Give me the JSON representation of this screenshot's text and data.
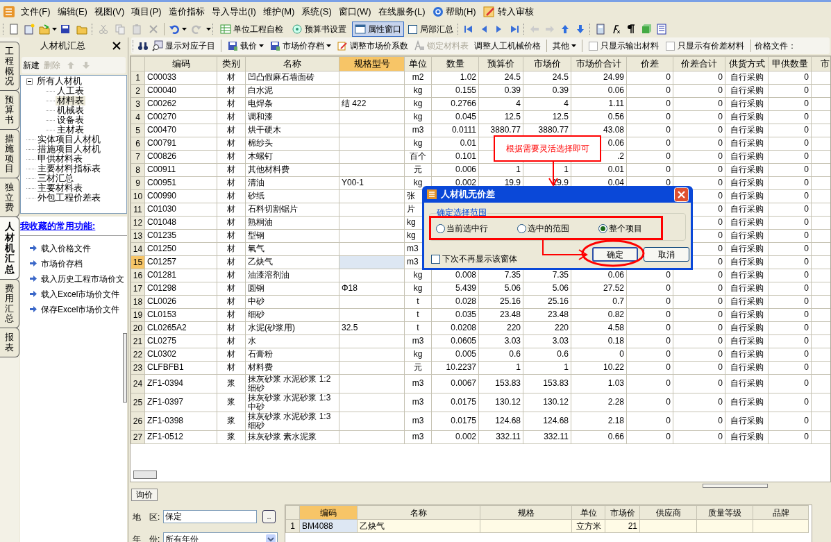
{
  "menu": [
    {
      "label": "文件(F)"
    },
    {
      "label": "编辑(E)"
    },
    {
      "label": "视图(V)"
    },
    {
      "label": "项目(P)"
    },
    {
      "label": "造价指标"
    },
    {
      "label": "导入导出(I)"
    },
    {
      "label": "维护(M)"
    },
    {
      "label": "系统(S)"
    },
    {
      "label": "窗口(W)"
    },
    {
      "label": "在线服务(L)"
    },
    {
      "label": "帮助(H)",
      "kind": "help"
    },
    {
      "label": "转入审核",
      "kind": "review"
    }
  ],
  "toolbar": [
    {
      "label": "单位工程自检",
      "pressed": false
    },
    {
      "label": "预算书设置",
      "pressed": false
    },
    {
      "label": "属性窗口",
      "pressed": true
    }
  ],
  "partial_summary": {
    "label": "局部汇总",
    "checked": false
  },
  "side_tabs": [
    {
      "label": "工程概况",
      "selected": false
    },
    {
      "label": "预算书",
      "selected": false
    },
    {
      "label": "措施项目",
      "selected": false
    },
    {
      "label": "独立费",
      "selected": false
    },
    {
      "label": "人材机汇总",
      "selected": true
    },
    {
      "label": "费用汇总",
      "selected": false
    },
    {
      "label": "报表",
      "selected": false
    }
  ],
  "panel": {
    "title": "人材机汇总",
    "actions": [
      {
        "label": "新建",
        "disabled": false
      },
      {
        "label": "删除",
        "disabled": true
      }
    ],
    "tree": [
      {
        "label": "所有人材机",
        "expanded": true,
        "selected": false,
        "children": [
          {
            "label": "人工表",
            "selected": false
          },
          {
            "label": "材料表",
            "selected": true
          },
          {
            "label": "机械表",
            "selected": false
          },
          {
            "label": "设备表",
            "selected": false
          },
          {
            "label": "主材表",
            "selected": false
          }
        ]
      },
      {
        "label": "实体项目人材机",
        "selected": false
      },
      {
        "label": "措施项目人材机",
        "selected": false
      },
      {
        "label": "甲供材料表",
        "selected": false
      },
      {
        "label": "主要材料指标表",
        "selected": false
      },
      {
        "label": "三材汇总",
        "selected": false
      },
      {
        "label": "主要材料表",
        "selected": false
      },
      {
        "label": "外包工程价差表",
        "selected": false
      }
    ],
    "favorites_title": "我收藏的常用功能:",
    "favorites": [
      "载入价格文件",
      "市场价存档",
      "载入历史工程市场价文",
      "载入Excel市场价文件",
      "保存Excel市场价文件"
    ]
  },
  "toolbar2": [
    {
      "kind": "button",
      "label": "显示对应子目",
      "disabled": false
    },
    {
      "kind": "dropdown",
      "label": "载价",
      "disabled": false
    },
    {
      "kind": "dropdown",
      "label": "市场价存档",
      "disabled": false
    },
    {
      "kind": "button",
      "label": "调整市场价系数",
      "disabled": false
    },
    {
      "kind": "button",
      "label": "锁定材料表",
      "disabled": true
    },
    {
      "kind": "button",
      "label": "调整人工机械价格",
      "disabled": false
    },
    {
      "kind": "dropdown",
      "label": "其他",
      "disabled": false
    },
    {
      "kind": "checkbox",
      "label": "只显示输出材料",
      "checked": false
    },
    {
      "kind": "checkbox",
      "label": "只显示有价差材料",
      "checked": false
    },
    {
      "kind": "label",
      "label": "价格文件："
    }
  ],
  "table": {
    "columns": [
      {
        "label": "编码",
        "selected": false
      },
      {
        "label": "类别",
        "selected": false
      },
      {
        "label": "名称",
        "selected": false
      },
      {
        "label": "规格型号",
        "selected": true
      },
      {
        "label": "单位",
        "selected": false
      },
      {
        "label": "数量",
        "selected": false
      },
      {
        "label": "预算价",
        "selected": false
      },
      {
        "label": "市场价",
        "selected": false
      },
      {
        "label": "市场价合计",
        "selected": false
      },
      {
        "label": "价差",
        "selected": false
      },
      {
        "label": "价差合计",
        "selected": false
      },
      {
        "label": "供货方式",
        "selected": false
      },
      {
        "label": "甲供数量",
        "selected": false
      },
      {
        "label": "市",
        "selected": false
      }
    ],
    "rows": [
      {
        "no": "1",
        "selected": false,
        "cells": [
          "C00033",
          "材",
          "凹凸假麻石墙面砖",
          null,
          "m2",
          "1.02",
          "24.5",
          "24.5",
          "24.99",
          "0",
          "0",
          "自行采购",
          "0"
        ]
      },
      {
        "no": "2",
        "selected": false,
        "cells": [
          "C00040",
          "材",
          "白水泥",
          null,
          "kg",
          "0.155",
          "0.39",
          "0.39",
          "0.06",
          "0",
          "0",
          "自行采购",
          "0"
        ]
      },
      {
        "no": "3",
        "selected": false,
        "cells": [
          "C00262",
          "材",
          "电焊条",
          "结 422",
          "kg",
          "0.2766",
          "4",
          "4",
          "1.11",
          "0",
          "0",
          "自行采购",
          "0"
        ]
      },
      {
        "no": "4",
        "selected": false,
        "cells": [
          "C00270",
          "材",
          "调和漆",
          null,
          "kg",
          "0.045",
          "12.5",
          "12.5",
          "0.56",
          "0",
          "0",
          "自行采购",
          "0"
        ]
      },
      {
        "no": "5",
        "selected": false,
        "cells": [
          "C00470",
          "材",
          "烘干硬木",
          null,
          "m3",
          "0.0111",
          "3880.77",
          "3880.77",
          "43.08",
          "0",
          "0",
          "自行采购",
          "0"
        ]
      },
      {
        "no": "6",
        "selected": false,
        "cells": [
          "C00791",
          "材",
          "棉纱头",
          null,
          "kg",
          "0.01",
          null,
          null,
          "0.06",
          "0",
          "0",
          "自行采购",
          "0"
        ]
      },
      {
        "no": "7",
        "selected": false,
        "cells": [
          "C00826",
          "材",
          "木螺钉",
          null,
          "百个",
          "0.101",
          null,
          null,
          ".2",
          "0",
          "0",
          "自行采购",
          "0"
        ]
      },
      {
        "no": "8",
        "selected": false,
        "cells": [
          "C00911",
          "材",
          "其他材料费",
          null,
          "元",
          "0.006",
          "1",
          "1",
          "0.01",
          "0",
          "0",
          "自行采购",
          "0"
        ]
      },
      {
        "no": "9",
        "selected": false,
        "cells": [
          "C00951",
          "材",
          "清油",
          "Y00-1",
          "kg",
          "0.002",
          "19.9",
          "19.9",
          "0.04",
          "0",
          "0",
          "自行采购",
          "0"
        ]
      },
      {
        "no": "10",
        "selected": false,
        "cells": [
          "C00990",
          "材",
          "砂纸",
          null,
          "张",
          null,
          null,
          null,
          null,
          null,
          "0",
          "自行采购",
          "0"
        ]
      },
      {
        "no": "11",
        "selected": false,
        "cells": [
          "C01030",
          "材",
          "石料切割锯片",
          null,
          "片",
          null,
          null,
          null,
          null,
          null,
          "0",
          "自行采购",
          "0"
        ]
      },
      {
        "no": "12",
        "selected": false,
        "cells": [
          "C01048",
          "材",
          "熟桐油",
          null,
          "kg",
          null,
          null,
          null,
          null,
          null,
          "0",
          "自行采购",
          "0"
        ]
      },
      {
        "no": "13",
        "selected": false,
        "cells": [
          "C01235",
          "材",
          "型钢",
          null,
          "kg",
          null,
          null,
          null,
          null,
          null,
          "0",
          "自行采购",
          "0"
        ]
      },
      {
        "no": "14",
        "selected": false,
        "cells": [
          "C01250",
          "材",
          "氧气",
          null,
          "m3",
          null,
          null,
          null,
          null,
          null,
          "0",
          "自行采购",
          "0"
        ]
      },
      {
        "no": "15",
        "selected": true,
        "cells": [
          "C01257",
          "材",
          "乙炔气",
          null,
          "m3",
          null,
          null,
          null,
          null,
          null,
          "0",
          "自行采购",
          "0"
        ]
      },
      {
        "no": "16",
        "selected": false,
        "cells": [
          "C01281",
          "材",
          "油漆溶剂油",
          null,
          "kg",
          "0.008",
          "7.35",
          "7.35",
          "0.06",
          "0",
          "0",
          "自行采购",
          "0"
        ]
      },
      {
        "no": "17",
        "selected": false,
        "cells": [
          "C01298",
          "材",
          "圆钢",
          "Φ18",
          "kg",
          "5.439",
          "5.06",
          "5.06",
          "27.52",
          "0",
          "0",
          "自行采购",
          "0"
        ]
      },
      {
        "no": "18",
        "selected": false,
        "cells": [
          "CL0026",
          "材",
          "中砂",
          null,
          "t",
          "0.028",
          "25.16",
          "25.16",
          "0.7",
          "0",
          "0",
          "自行采购",
          "0"
        ]
      },
      {
        "no": "19",
        "selected": false,
        "cells": [
          "CL0153",
          "材",
          "细砂",
          null,
          "t",
          "0.035",
          "23.48",
          "23.48",
          "0.82",
          "0",
          "0",
          "自行采购",
          "0"
        ]
      },
      {
        "no": "20",
        "selected": false,
        "cells": [
          "CL0265A2",
          "材",
          "水泥(砂浆用)",
          "32.5",
          "t",
          "0.0208",
          "220",
          "220",
          "4.58",
          "0",
          "0",
          "自行采购",
          "0"
        ]
      },
      {
        "no": "21",
        "selected": false,
        "cells": [
          "CL0275",
          "材",
          "水",
          null,
          "m3",
          "0.0605",
          "3.03",
          "3.03",
          "0.18",
          "0",
          "0",
          "自行采购",
          "0"
        ]
      },
      {
        "no": "22",
        "selected": false,
        "cells": [
          "CL0302",
          "材",
          "石膏粉",
          null,
          "kg",
          "0.005",
          "0.6",
          "0.6",
          "0",
          "0",
          "0",
          "自行采购",
          "0"
        ]
      },
      {
        "no": "23",
        "selected": false,
        "cells": [
          "CLFBFB1",
          "材",
          "材料费",
          null,
          "元",
          "10.2237",
          "1",
          "1",
          "10.22",
          "0",
          "0",
          "自行采购",
          "0"
        ]
      },
      {
        "no": "24",
        "selected": false,
        "cells": [
          "ZF1-0394",
          "浆",
          "抹灰砂浆 水泥砂浆 1:2 细砂",
          null,
          "m3",
          "0.0067",
          "153.83",
          "153.83",
          "1.03",
          "0",
          "0",
          "自行采购",
          "0"
        ]
      },
      {
        "no": "25",
        "selected": false,
        "cells": [
          "ZF1-0397",
          "浆",
          "抹灰砂浆 水泥砂浆 1:3 中砂",
          null,
          "m3",
          "0.0175",
          "130.12",
          "130.12",
          "2.28",
          "0",
          "0",
          "自行采购",
          "0"
        ]
      },
      {
        "no": "26",
        "selected": false,
        "cells": [
          "ZF1-0398",
          "浆",
          "抹灰砂浆 水泥砂浆 1:3 细砂",
          null,
          "m3",
          "0.0175",
          "124.68",
          "124.68",
          "2.18",
          "0",
          "0",
          "自行采购",
          "0"
        ]
      },
      {
        "no": "27",
        "selected": false,
        "cells": [
          "ZF1-0512",
          "浆",
          "抹灰砂浆 素水泥浆",
          null,
          "m3",
          "0.002",
          "332.11",
          "332.11",
          "0.66",
          "0",
          "0",
          "自行采购",
          "0"
        ]
      }
    ]
  },
  "bottom": {
    "tab": {
      "label": "询价",
      "selected": true
    },
    "region_label": "地　区:",
    "region_value": "保定",
    "browse": "..",
    "year_label": "年　份:",
    "year_value": "所有年份",
    "table": {
      "columns": [
        "编码",
        "名称",
        "规格",
        "单位",
        "市场价",
        "供应商",
        "质量等级",
        "品牌"
      ],
      "rows": [
        {
          "no": "1",
          "cells": [
            "BM4088",
            "乙炔气",
            null,
            "立方米",
            "21",
            null,
            null,
            null
          ]
        }
      ]
    }
  },
  "dialog": {
    "title": "人材机无价差",
    "group": "确定选择范围",
    "options": [
      {
        "label": "当前选中行",
        "selected": false
      },
      {
        "label": "选中的范围",
        "selected": false
      },
      {
        "label": "整个项目",
        "selected": true
      }
    ],
    "dont_show": {
      "label": "下次不再显示该窗体",
      "checked": false
    },
    "buttons": [
      "确定",
      "取消"
    ]
  },
  "annotation": {
    "text": "根据需要灵活选择即可"
  }
}
